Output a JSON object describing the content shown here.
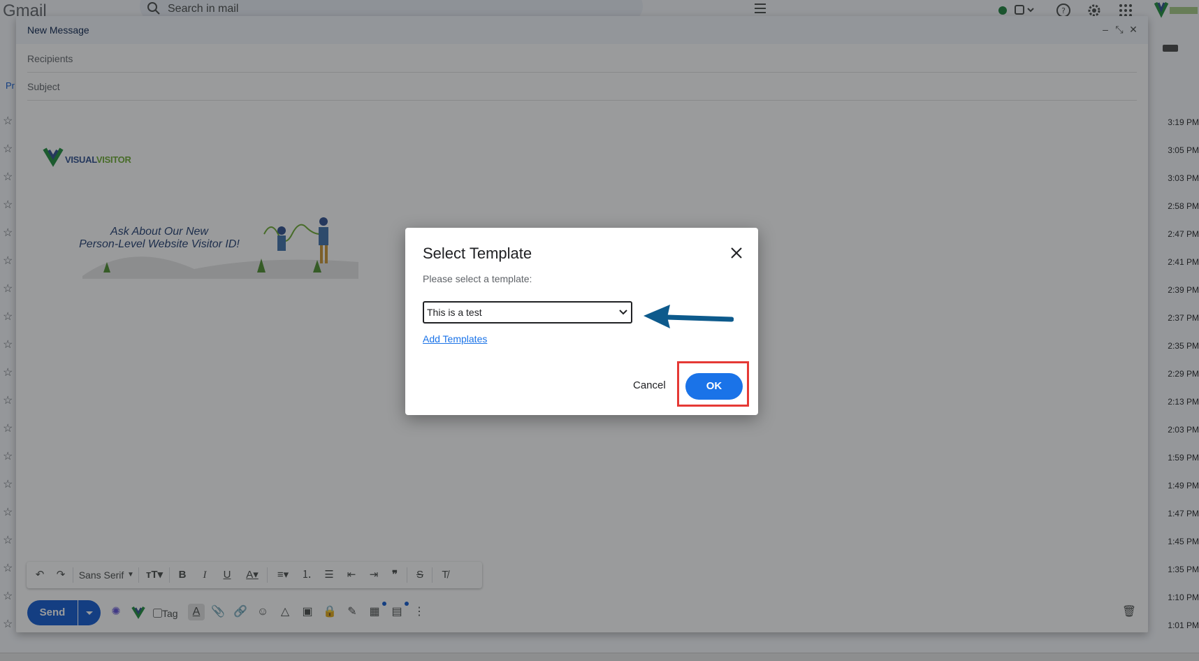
{
  "gmail": {
    "logo": "Gmail",
    "search_placeholder": "Search in mail",
    "left_tab": "Pr",
    "times": [
      "3:19 PM",
      "3:05 PM",
      "3:03 PM",
      "2:58 PM",
      "2:47 PM",
      "2:41 PM",
      "2:39 PM",
      "2:37 PM",
      "2:35 PM",
      "2:29 PM",
      "2:13 PM",
      "2:03 PM",
      "1:59 PM",
      "1:49 PM",
      "1:47 PM",
      "1:45 PM",
      "1:35 PM",
      "1:10 PM",
      "1:01 PM"
    ]
  },
  "compose": {
    "title": "New Message",
    "recipients_placeholder": "Recipients",
    "subject_placeholder": "Subject",
    "signature": {
      "logo_left": "VISUAL",
      "logo_right": "VISITOR",
      "banner_line1": "Ask About Our New",
      "banner_line2": "Person-Level Website Visitor ID!"
    },
    "toolbar": {
      "font": "Sans Serif"
    },
    "send_label": "Send",
    "tag_label": "Tag"
  },
  "dialog": {
    "title": "Select Template",
    "prompt": "Please select a template:",
    "selected_template": "This is a test",
    "add_templates_link": "Add Templates",
    "cancel_label": "Cancel",
    "ok_label": "OK"
  },
  "colors": {
    "accent": "#1a73e8",
    "send": "#0b57d0",
    "highlight": "#e53935",
    "arrow": "#0d5a8c"
  }
}
